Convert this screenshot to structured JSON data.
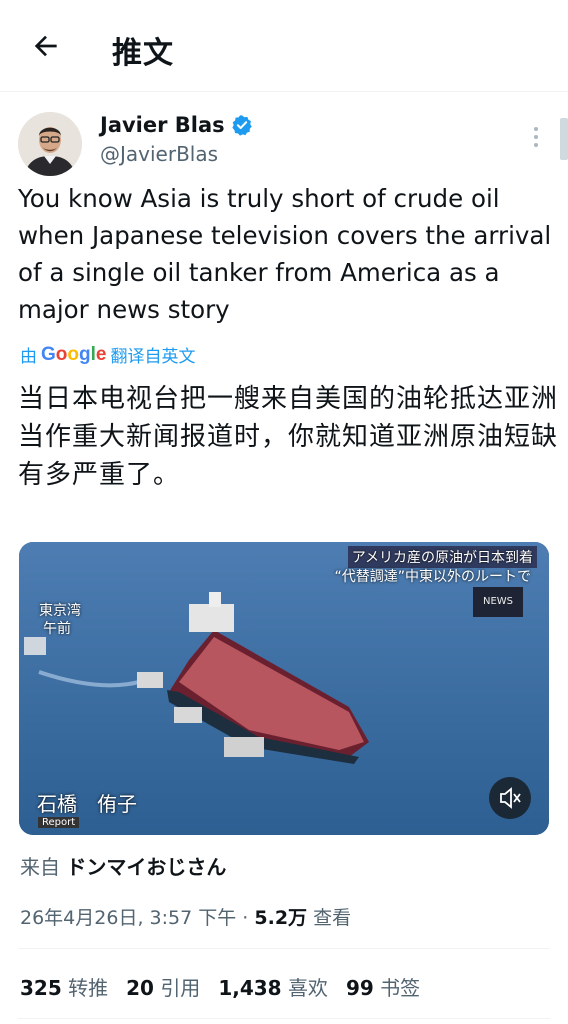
{
  "header": {
    "title": "推文",
    "back_icon": "arrow-left-icon"
  },
  "author": {
    "name": "Javier Blas",
    "handle": "@JavierBlas",
    "verified_icon": "verified-badge-icon"
  },
  "tweet": {
    "text_en": "You know Asia is truly short of crude oil when Japanese television covers the arrival of a single oil tanker from America as a major news story",
    "translate_prefix": "由",
    "translate_brand": "Google",
    "translate_suffix": "翻译自英文",
    "text_zh": "当日本电视台把一艘来自美国的油轮抵达亚洲当作重大新闻报道时，你就知道亚洲原油短缺有多严重了。"
  },
  "media": {
    "caption_line1": "アメリカ産の原油が日本到着",
    "caption_line2": "“代替調達”中東以外のルートで",
    "channel_tag": "NEWS",
    "location_line1": "東京湾",
    "location_line2": "午前",
    "reporter": "石橋　侑子",
    "report_tag": "Report",
    "mute_icon": "speaker-muted-icon"
  },
  "source": {
    "prefix": "来自",
    "name": "ドンマイおじさん"
  },
  "meta": {
    "datetime": "26年4月26日, 3:57 下午",
    "dot": "·",
    "views": "5.2万",
    "views_label": "查看"
  },
  "stats": {
    "retweets": "325",
    "retweets_label": "转推",
    "quotes": "20",
    "quotes_label": "引用",
    "likes": "1,438",
    "likes_label": "喜欢",
    "bookmarks": "99",
    "bookmarks_label": "书签"
  },
  "colors": {
    "accent": "#1d9bf0",
    "text": "#0f1419",
    "secondary": "#536471"
  }
}
